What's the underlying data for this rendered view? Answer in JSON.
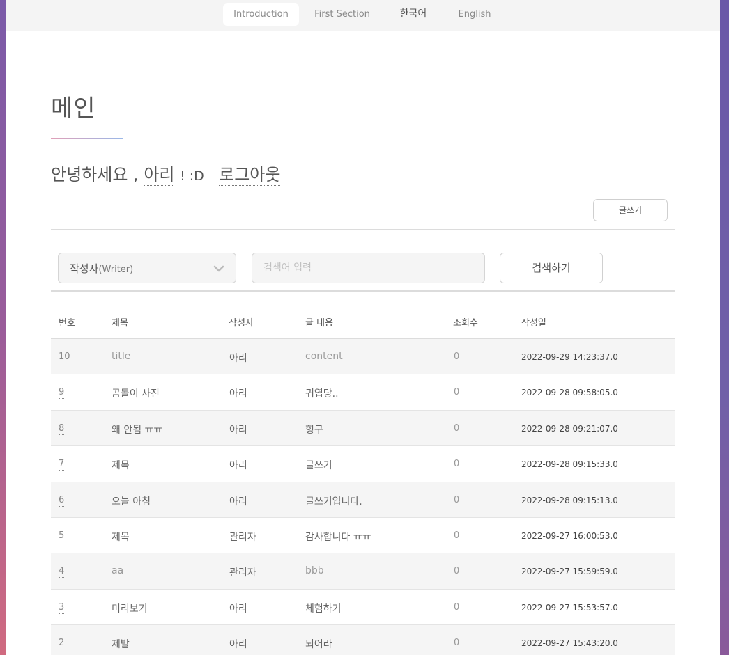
{
  "nav": {
    "items": [
      {
        "label": "Introduction",
        "active": true
      },
      {
        "label": "First Section",
        "active": false
      },
      {
        "label": "한국어",
        "active": false
      },
      {
        "label": "English",
        "active": false
      }
    ]
  },
  "main": {
    "title": "메인",
    "greeting": {
      "prefix": "안녕하세요 ,",
      "username": "아리",
      "suffix": "! :D",
      "logout": "로그아웃"
    },
    "write_button": "글쓰기"
  },
  "search": {
    "select_label": "작성자",
    "select_sub": "(Writer)",
    "placeholder": "검색어 입력",
    "button": "검색하기"
  },
  "table": {
    "headers": [
      "번호",
      "제목",
      "작성자",
      "글 내용",
      "조회수",
      "작성일"
    ],
    "rows": [
      {
        "num": "10",
        "title": "title",
        "writer": "아리",
        "content": "content",
        "views": "0",
        "date": "2022-09-29 14:23:37.0"
      },
      {
        "num": "9",
        "title": "곰돌이 사진",
        "writer": "아리",
        "content": "귀엽당..",
        "views": "0",
        "date": "2022-09-28 09:58:05.0"
      },
      {
        "num": "8",
        "title": "왜 안됨 ㅠㅠ",
        "writer": "아리",
        "content": "힝구",
        "views": "0",
        "date": "2022-09-28 09:21:07.0"
      },
      {
        "num": "7",
        "title": "제목",
        "writer": "아리",
        "content": "글쓰기",
        "views": "0",
        "date": "2022-09-28 09:15:33.0"
      },
      {
        "num": "6",
        "title": "오늘 아침",
        "writer": "아리",
        "content": "글쓰기입니다.",
        "views": "0",
        "date": "2022-09-28 09:15:13.0"
      },
      {
        "num": "5",
        "title": "제목",
        "writer": "관리자",
        "content": "감사합니다 ㅠㅠ",
        "views": "0",
        "date": "2022-09-27 16:00:53.0"
      },
      {
        "num": "4",
        "title": "aa",
        "writer": "관리자",
        "content": "bbb",
        "views": "0",
        "date": "2022-09-27 15:59:59.0"
      },
      {
        "num": "3",
        "title": "미리보기",
        "writer": "아리",
        "content": "체험하기",
        "views": "0",
        "date": "2022-09-27 15:53:57.0"
      },
      {
        "num": "2",
        "title": "제발",
        "writer": "아리",
        "content": "되어라",
        "views": "0",
        "date": "2022-09-27 15:43:20.0"
      }
    ]
  }
}
